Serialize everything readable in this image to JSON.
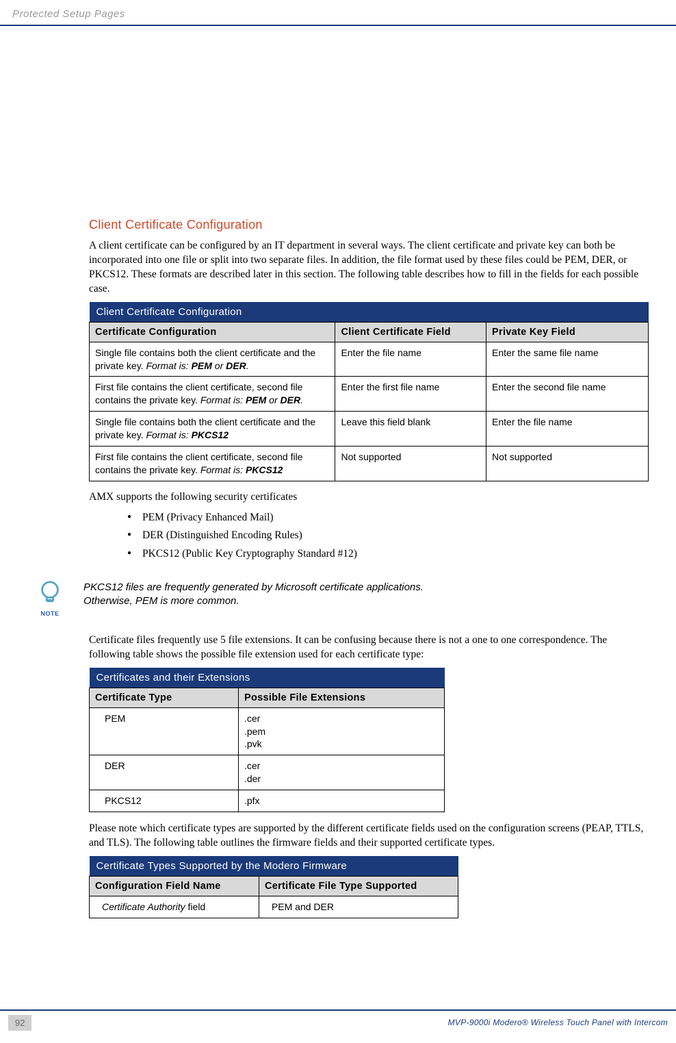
{
  "header": {
    "title": "Protected Setup Pages"
  },
  "section": {
    "title": "Client Certificate Configuration",
    "intro": "A client certificate can be configured by an IT department in several ways. The client certificate and private key can both be incorporated into one file or split into two separate files. In addition, the file format used by these files could be PEM, DER, or PKCS12. These formats are described later in this section. The following table describes how to fill in the fields for each possible case."
  },
  "table1": {
    "caption": "Client Certificate Configuration",
    "headers": [
      "Certificate Configuration",
      "Client Certificate Field",
      "Private Key Field"
    ],
    "rows": [
      {
        "c1_pre": "Single file contains both the client certificate and the private key. ",
        "c1_fmt_label": "Format is: ",
        "c1_fmt_val": "PEM",
        "c1_or": " or ",
        "c1_fmt_val2": "DER",
        "c1_end": ".",
        "c2": "Enter the file name",
        "c3": "Enter the same file name"
      },
      {
        "c1_pre": "First file contains the client certificate, second file contains the private key. ",
        "c1_fmt_label": "Format is: ",
        "c1_fmt_val": "PEM",
        "c1_or": " or ",
        "c1_fmt_val2": "DER",
        "c1_end": ".",
        "c2": "Enter the first file name",
        "c3": "Enter the second file name"
      },
      {
        "c1_pre": "Single file contains both the client certificate and the private key. ",
        "c1_fmt_label": "Format is: ",
        "c1_fmt_val": "PKCS12",
        "c1_or": "",
        "c1_fmt_val2": "",
        "c1_end": "",
        "c2": "Leave this field blank",
        "c3": "Enter the file name"
      },
      {
        "c1_pre": "First file contains the client certificate, second file contains the private key. ",
        "c1_fmt_label": "Format is: ",
        "c1_fmt_val": "PKCS12",
        "c1_or": "",
        "c1_fmt_val2": "",
        "c1_end": "",
        "c2": "Not supported",
        "c3": "Not supported"
      }
    ]
  },
  "cert_intro": "AMX supports the following security certificates",
  "cert_list": [
    "PEM (Privacy Enhanced Mail)",
    "DER (Distinguished Encoding Rules)",
    "PKCS12 (Public Key Cryptography Standard #12)"
  ],
  "note": {
    "label": "NOTE",
    "line1": "PKCS12 files are frequently generated by Microsoft certificate applications.",
    "line2": "Otherwise, PEM is more common."
  },
  "ext_intro": "Certificate files frequently use 5 file extensions. It can be confusing because there is not a one to one correspondence. The following table shows the possible file extension used for each certificate type:",
  "table2": {
    "caption": "Certificates and their Extensions",
    "headers": [
      "Certificate Type",
      "Possible File Extensions"
    ],
    "rows": [
      {
        "type": "PEM",
        "ext": [
          ".cer",
          ".pem",
          ".pvk"
        ]
      },
      {
        "type": "DER",
        "ext": [
          ".cer",
          ".der"
        ]
      },
      {
        "type": "PKCS12",
        "ext": [
          ".pfx"
        ]
      }
    ]
  },
  "fw_intro": "Please note which certificate types are supported by the different certificate fields used on the configuration screens (PEAP, TTLS, and TLS). The following table outlines the firmware fields and their supported certificate types.",
  "table3": {
    "caption": "Certificate Types Supported by the Modero Firmware",
    "headers": [
      "Configuration Field Name",
      "Certificate File Type Supported"
    ],
    "rows": [
      {
        "name_italic": "Certificate Authority",
        "name_rest": " field",
        "type": "PEM and DER"
      }
    ]
  },
  "footer": {
    "page": "92",
    "product": "MVP-9000i Modero® Wireless Touch Panel with Intercom"
  }
}
